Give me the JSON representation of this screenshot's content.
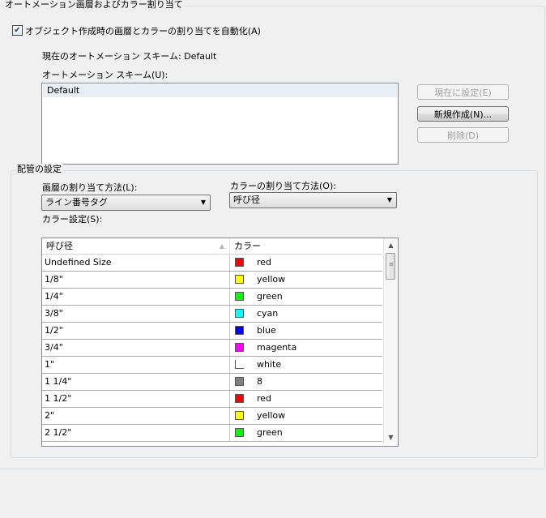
{
  "automation_group": {
    "title": "オートメーション画層およびカラー割り当て",
    "auto_checkbox_label": "オブジェクト作成時の画層とカラーの割り当てを自動化(A)",
    "auto_checked": true,
    "current_scheme_label": "現在のオートメーション スキーム: Default",
    "scheme_list_label": "オートメーション スキーム(U):",
    "scheme_items": [
      "Default"
    ],
    "buttons": {
      "set_current": "現在に設定(E)",
      "new": "新規作成(N)...",
      "delete": "削除(D)"
    }
  },
  "piping_group": {
    "title": "配管の設定",
    "layer_method_label": "画層の割り当て方法(L):",
    "layer_method_value": "ライン番号タグ",
    "color_method_label": "カラーの割り当て方法(O):",
    "color_method_value": "呼び径",
    "color_settings_label": "カラー設定(S):",
    "table": {
      "headers": [
        "呼び径",
        "カラー"
      ],
      "rows": [
        {
          "size": "Undefined Size",
          "color_name": "red",
          "swatch": "#ff0000"
        },
        {
          "size": "1/8\"",
          "color_name": "yellow",
          "swatch": "#ffff00"
        },
        {
          "size": "1/4\"",
          "color_name": "green",
          "swatch": "#00ff00"
        },
        {
          "size": "3/8\"",
          "color_name": "cyan",
          "swatch": "#00ffff"
        },
        {
          "size": "1/2\"",
          "color_name": "blue",
          "swatch": "#0000ff"
        },
        {
          "size": "3/4\"",
          "color_name": "magenta",
          "swatch": "#ff00ff"
        },
        {
          "size": "1\"",
          "color_name": "white",
          "swatch": "#ffffff"
        },
        {
          "size": "1 1/4\"",
          "color_name": "8",
          "swatch": "#808080"
        },
        {
          "size": "1 1/2\"",
          "color_name": "red",
          "swatch": "#ff0000"
        },
        {
          "size": "2\"",
          "color_name": "yellow",
          "swatch": "#ffff00"
        },
        {
          "size": "2 1/2\"",
          "color_name": "green",
          "swatch": "#00ff00"
        }
      ]
    }
  },
  "colors": {
    "background": "#f0f0f0",
    "group_border": "#d5dfe5",
    "list_selection": "#e8eef5",
    "disabled_text": "#a0a0a0"
  }
}
